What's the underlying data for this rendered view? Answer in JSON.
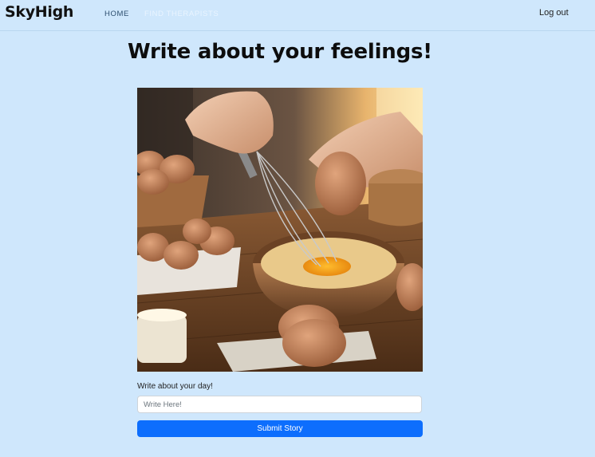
{
  "navbar": {
    "brand": "SkyHigh",
    "links": [
      {
        "label": "HOME"
      },
      {
        "label": "FIND THERAPISTS"
      }
    ],
    "logout_label": "Log out"
  },
  "main": {
    "title": "Write about your feelings!",
    "form": {
      "label": "Write about your day!",
      "input_placeholder": "Write Here!",
      "input_value": "",
      "submit_label": "Submit Story"
    }
  },
  "colors": {
    "page_background": "#cfe7fc",
    "primary_button": "#0d6efd",
    "active_nav_link": "#2c4e6e",
    "inactive_nav_link": "#e9f4ff"
  }
}
